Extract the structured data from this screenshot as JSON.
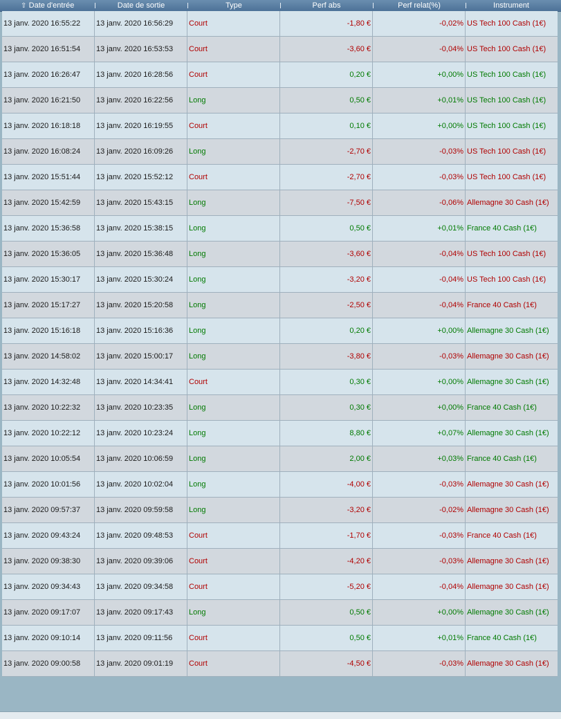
{
  "header": {
    "entry_date": "Date d'entrée",
    "exit_date": "Date de sortie",
    "type": "Type",
    "perf_abs": "Perf abs",
    "perf_rel": "Perf relat(%)",
    "instrument": "Instrument",
    "sort_icon": "⇧"
  },
  "rows": [
    {
      "entry": "13 janv. 2020 16:55:22",
      "exit": "13 janv. 2020 16:56:29",
      "type": "Court",
      "abs": "-1,80 €",
      "rel": "-0,02%",
      "instrument": "US Tech 100 Cash (1€)",
      "type_dir": "neg",
      "abs_dir": "neg",
      "rel_dir": "neg"
    },
    {
      "entry": "13 janv. 2020 16:51:54",
      "exit": "13 janv. 2020 16:53:53",
      "type": "Court",
      "abs": "-3,60 €",
      "rel": "-0,04%",
      "instrument": "US Tech 100 Cash (1€)",
      "type_dir": "neg",
      "abs_dir": "neg",
      "rel_dir": "neg"
    },
    {
      "entry": "13 janv. 2020 16:26:47",
      "exit": "13 janv. 2020 16:28:56",
      "type": "Court",
      "abs": "0,20 €",
      "rel": "+0,00%",
      "instrument": "US Tech 100 Cash (1€)",
      "type_dir": "neg",
      "abs_dir": "pos",
      "rel_dir": "pos"
    },
    {
      "entry": "13 janv. 2020 16:21:50",
      "exit": "13 janv. 2020 16:22:56",
      "type": "Long",
      "abs": "0,50 €",
      "rel": "+0,01%",
      "instrument": "US Tech 100 Cash (1€)",
      "type_dir": "pos",
      "abs_dir": "pos",
      "rel_dir": "pos"
    },
    {
      "entry": "13 janv. 2020 16:18:18",
      "exit": "13 janv. 2020 16:19:55",
      "type": "Court",
      "abs": "0,10 €",
      "rel": "+0,00%",
      "instrument": "US Tech 100 Cash (1€)",
      "type_dir": "neg",
      "abs_dir": "pos",
      "rel_dir": "pos"
    },
    {
      "entry": "13 janv. 2020 16:08:24",
      "exit": "13 janv. 2020 16:09:26",
      "type": "Long",
      "abs": "-2,70 €",
      "rel": "-0,03%",
      "instrument": "US Tech 100 Cash (1€)",
      "type_dir": "pos",
      "abs_dir": "neg",
      "rel_dir": "neg"
    },
    {
      "entry": "13 janv. 2020 15:51:44",
      "exit": "13 janv. 2020 15:52:12",
      "type": "Court",
      "abs": "-2,70 €",
      "rel": "-0,03%",
      "instrument": "US Tech 100 Cash (1€)",
      "type_dir": "neg",
      "abs_dir": "neg",
      "rel_dir": "neg"
    },
    {
      "entry": "13 janv. 2020 15:42:59",
      "exit": "13 janv. 2020 15:43:15",
      "type": "Long",
      "abs": "-7,50 €",
      "rel": "-0,06%",
      "instrument": "Allemagne 30 Cash (1€)",
      "type_dir": "pos",
      "abs_dir": "neg",
      "rel_dir": "neg"
    },
    {
      "entry": "13 janv. 2020 15:36:58",
      "exit": "13 janv. 2020 15:38:15",
      "type": "Long",
      "abs": "0,50 €",
      "rel": "+0,01%",
      "instrument": "France 40 Cash (1€)",
      "type_dir": "pos",
      "abs_dir": "pos",
      "rel_dir": "pos"
    },
    {
      "entry": "13 janv. 2020 15:36:05",
      "exit": "13 janv. 2020 15:36:48",
      "type": "Long",
      "abs": "-3,60 €",
      "rel": "-0,04%",
      "instrument": "US Tech 100 Cash (1€)",
      "type_dir": "pos",
      "abs_dir": "neg",
      "rel_dir": "neg"
    },
    {
      "entry": "13 janv. 2020 15:30:17",
      "exit": "13 janv. 2020 15:30:24",
      "type": "Long",
      "abs": "-3,20 €",
      "rel": "-0,04%",
      "instrument": "US Tech 100 Cash (1€)",
      "type_dir": "pos",
      "abs_dir": "neg",
      "rel_dir": "neg"
    },
    {
      "entry": "13 janv. 2020 15:17:27",
      "exit": "13 janv. 2020 15:20:58",
      "type": "Long",
      "abs": "-2,50 €",
      "rel": "-0,04%",
      "instrument": "France 40 Cash (1€)",
      "type_dir": "pos",
      "abs_dir": "neg",
      "rel_dir": "neg"
    },
    {
      "entry": "13 janv. 2020 15:16:18",
      "exit": "13 janv. 2020 15:16:36",
      "type": "Long",
      "abs": "0,20 €",
      "rel": "+0,00%",
      "instrument": "Allemagne 30 Cash (1€)",
      "type_dir": "pos",
      "abs_dir": "pos",
      "rel_dir": "pos"
    },
    {
      "entry": "13 janv. 2020 14:58:02",
      "exit": "13 janv. 2020 15:00:17",
      "type": "Long",
      "abs": "-3,80 €",
      "rel": "-0,03%",
      "instrument": "Allemagne 30 Cash (1€)",
      "type_dir": "pos",
      "abs_dir": "neg",
      "rel_dir": "neg"
    },
    {
      "entry": "13 janv. 2020 14:32:48",
      "exit": "13 janv. 2020 14:34:41",
      "type": "Court",
      "abs": "0,30 €",
      "rel": "+0,00%",
      "instrument": "Allemagne 30 Cash (1€)",
      "type_dir": "neg",
      "abs_dir": "pos",
      "rel_dir": "pos"
    },
    {
      "entry": "13 janv. 2020 10:22:32",
      "exit": "13 janv. 2020 10:23:35",
      "type": "Long",
      "abs": "0,30 €",
      "rel": "+0,00%",
      "instrument": "France 40 Cash (1€)",
      "type_dir": "pos",
      "abs_dir": "pos",
      "rel_dir": "pos"
    },
    {
      "entry": "13 janv. 2020 10:22:12",
      "exit": "13 janv. 2020 10:23:24",
      "type": "Long",
      "abs": "8,80 €",
      "rel": "+0,07%",
      "instrument": "Allemagne 30 Cash (1€)",
      "type_dir": "pos",
      "abs_dir": "pos",
      "rel_dir": "pos"
    },
    {
      "entry": "13 janv. 2020 10:05:54",
      "exit": "13 janv. 2020 10:06:59",
      "type": "Long",
      "abs": "2,00 €",
      "rel": "+0,03%",
      "instrument": "France 40 Cash (1€)",
      "type_dir": "pos",
      "abs_dir": "pos",
      "rel_dir": "pos"
    },
    {
      "entry": "13 janv. 2020 10:01:56",
      "exit": "13 janv. 2020 10:02:04",
      "type": "Long",
      "abs": "-4,00 €",
      "rel": "-0,03%",
      "instrument": "Allemagne 30 Cash (1€)",
      "type_dir": "pos",
      "abs_dir": "neg",
      "rel_dir": "neg"
    },
    {
      "entry": "13 janv. 2020 09:57:37",
      "exit": "13 janv. 2020 09:59:58",
      "type": "Long",
      "abs": "-3,20 €",
      "rel": "-0,02%",
      "instrument": "Allemagne 30 Cash (1€)",
      "type_dir": "pos",
      "abs_dir": "neg",
      "rel_dir": "neg"
    },
    {
      "entry": "13 janv. 2020 09:43:24",
      "exit": "13 janv. 2020 09:48:53",
      "type": "Court",
      "abs": "-1,70 €",
      "rel": "-0,03%",
      "instrument": "France 40 Cash (1€)",
      "type_dir": "neg",
      "abs_dir": "neg",
      "rel_dir": "neg"
    },
    {
      "entry": "13 janv. 2020 09:38:30",
      "exit": "13 janv. 2020 09:39:06",
      "type": "Court",
      "abs": "-4,20 €",
      "rel": "-0,03%",
      "instrument": "Allemagne 30 Cash (1€)",
      "type_dir": "neg",
      "abs_dir": "neg",
      "rel_dir": "neg"
    },
    {
      "entry": "13 janv. 2020 09:34:43",
      "exit": "13 janv. 2020 09:34:58",
      "type": "Court",
      "abs": "-5,20 €",
      "rel": "-0,04%",
      "instrument": "Allemagne 30 Cash (1€)",
      "type_dir": "neg",
      "abs_dir": "neg",
      "rel_dir": "neg"
    },
    {
      "entry": "13 janv. 2020 09:17:07",
      "exit": "13 janv. 2020 09:17:43",
      "type": "Long",
      "abs": "0,50 €",
      "rel": "+0,00%",
      "instrument": "Allemagne 30 Cash (1€)",
      "type_dir": "pos",
      "abs_dir": "pos",
      "rel_dir": "pos"
    },
    {
      "entry": "13 janv. 2020 09:10:14",
      "exit": "13 janv. 2020 09:11:56",
      "type": "Court",
      "abs": "0,50 €",
      "rel": "+0,01%",
      "instrument": "France 40 Cash (1€)",
      "type_dir": "neg",
      "abs_dir": "pos",
      "rel_dir": "pos"
    },
    {
      "entry": "13 janv. 2020 09:00:58",
      "exit": "13 janv. 2020 09:01:19",
      "type": "Court",
      "abs": "-4,50 €",
      "rel": "-0,03%",
      "instrument": "Allemagne 30 Cash (1€)",
      "type_dir": "neg",
      "abs_dir": "neg",
      "rel_dir": "neg"
    }
  ],
  "colors": {
    "negative": "#b00000",
    "positive": "#007a00",
    "header": "#5a7fa4"
  }
}
